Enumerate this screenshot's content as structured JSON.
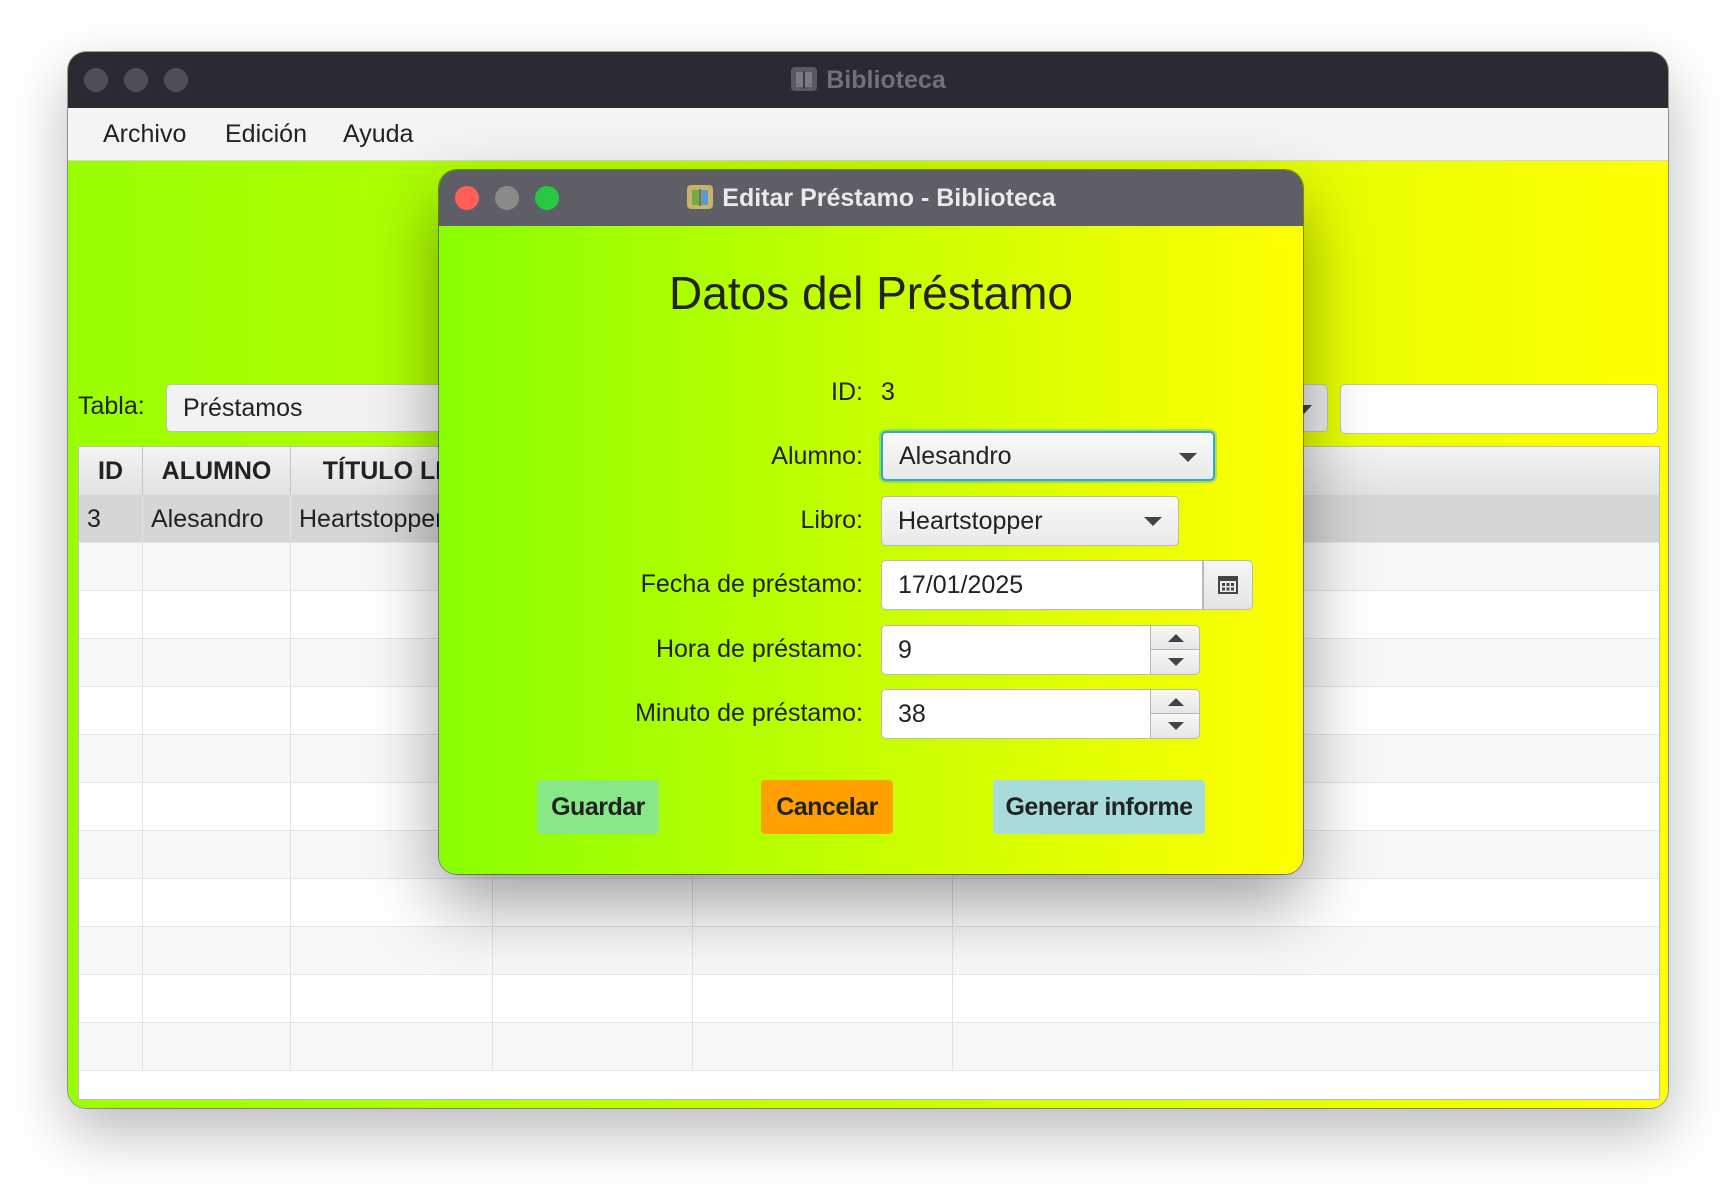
{
  "main_window": {
    "title": "Biblioteca",
    "menu": [
      "Archivo",
      "Edición",
      "Ayuda"
    ],
    "tabla_label": "Tabla:",
    "tabla_value": "Préstamos",
    "search_value": "",
    "table": {
      "columns": [
        "ID",
        "ALUMNO",
        "TÍTULO LIB"
      ],
      "rows": [
        {
          "id": "3",
          "alumno": "Alesandro",
          "titulo": "Heartstopper"
        }
      ]
    }
  },
  "dialog": {
    "title": "Editar Préstamo - Biblioteca",
    "heading": "Datos del Préstamo",
    "labels": {
      "id": "ID:",
      "alumno": "Alumno:",
      "libro": "Libro:",
      "fecha": "Fecha de préstamo:",
      "hora": "Hora de préstamo:",
      "minuto": "Minuto de préstamo:"
    },
    "values": {
      "id": "3",
      "alumno": "Alesandro",
      "libro": "Heartstopper",
      "fecha": "17/01/2025",
      "hora": "9",
      "minuto": "38"
    },
    "buttons": {
      "guardar": "Guardar",
      "cancelar": "Cancelar",
      "informe": "Generar informe"
    }
  },
  "colors": {
    "gradient_start": "#99ff00",
    "gradient_end": "#ffff00",
    "guardar_bg": "#88e888",
    "cancelar_bg": "#ffa000",
    "informe_bg": "#a8dcdc",
    "close": "#ff5f57",
    "minimize": "#8a8a8a",
    "maximize": "#28c840",
    "focus_ring": "#2fa7d6"
  },
  "icons": {
    "app": "book-icon",
    "calendar": "calendar-icon"
  }
}
